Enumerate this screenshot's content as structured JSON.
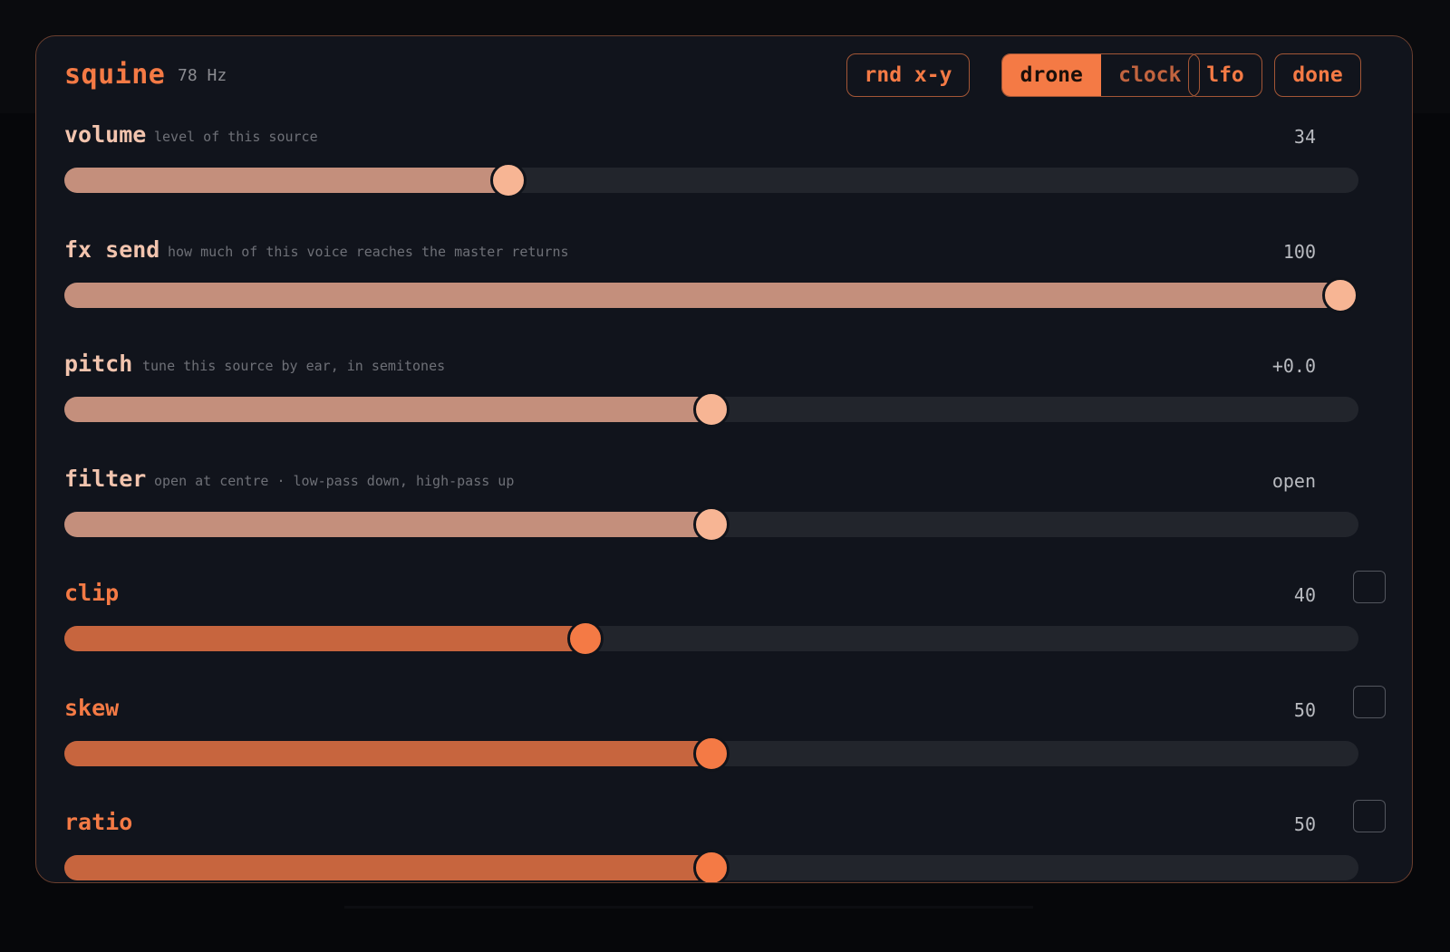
{
  "header": {
    "title": "squine",
    "frequency": "78 Hz",
    "buttons": {
      "rnd": "rnd x-y",
      "lfo": "lfo",
      "done": "done"
    },
    "mode": {
      "options": [
        "drone",
        "clock"
      ],
      "selected": "drone"
    }
  },
  "colors": {
    "accent": "#f47a45",
    "panel_bg": "#11141c",
    "light_fill": "#c48f7c",
    "accent_fill": "#c7653e",
    "track": "#22252c"
  },
  "sliders": [
    {
      "label": "volume",
      "description": "level of this source",
      "value": "34",
      "fraction": 0.343,
      "style": "light",
      "checkbox": false
    },
    {
      "label": "fx send",
      "description": "how much of this voice reaches the master returns",
      "value": "100",
      "fraction": 0.986,
      "style": "light",
      "checkbox": false
    },
    {
      "label": "pitch",
      "description": "tune this source by ear, in semitones",
      "value": "+0.0",
      "fraction": 0.5,
      "style": "light",
      "checkbox": false
    },
    {
      "label": "filter",
      "description": "open at centre · low-pass down, high-pass up",
      "value": "open",
      "fraction": 0.5,
      "style": "light",
      "checkbox": false
    },
    {
      "label": "clip",
      "description": "",
      "value": "40",
      "fraction": 0.403,
      "style": "accent",
      "checkbox": true,
      "checked": false
    },
    {
      "label": "skew",
      "description": "",
      "value": "50",
      "fraction": 0.5,
      "style": "accent",
      "checkbox": true,
      "checked": false
    },
    {
      "label": "ratio",
      "description": "",
      "value": "50",
      "fraction": 0.5,
      "style": "accent",
      "checkbox": true,
      "checked": false
    }
  ]
}
